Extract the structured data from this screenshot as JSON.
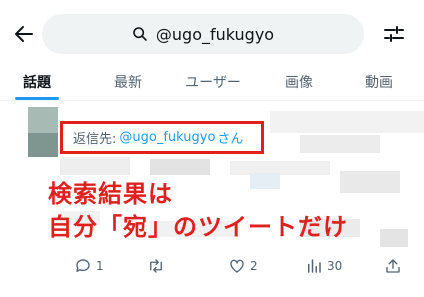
{
  "header": {
    "search_query": "@ugo_fukugyo"
  },
  "tabs": [
    {
      "label": "話題",
      "active": true
    },
    {
      "label": "最新",
      "active": false
    },
    {
      "label": "ユーザー",
      "active": false
    },
    {
      "label": "画像",
      "active": false
    },
    {
      "label": "動画",
      "active": false
    }
  ],
  "post": {
    "reply_label": "返信先:",
    "reply_handle": "@ugo_fukugyo",
    "reply_suffix": "さん",
    "annotation_line1": "検索結果は",
    "annotation_line2": "自分「宛」のツイートだけ",
    "actions": {
      "reply_count": "1",
      "retweet_count": "",
      "like_count": "2",
      "views_count": "30"
    }
  },
  "colors": {
    "accent": "#1d9bf0",
    "annotation": "#e0201e"
  }
}
